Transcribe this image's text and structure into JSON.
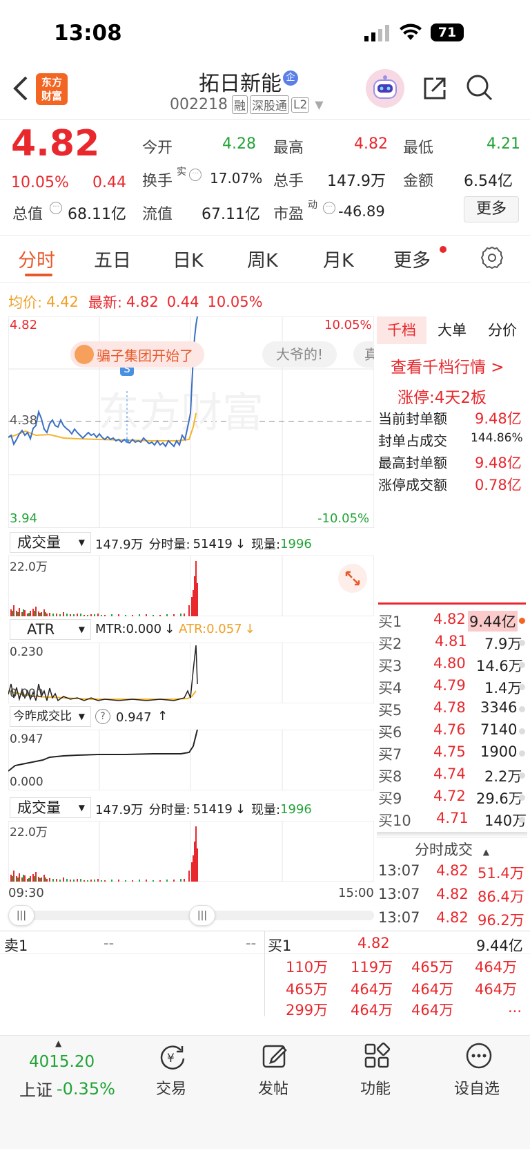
{
  "status": {
    "time": "13:08",
    "battery": "71"
  },
  "header": {
    "logo_line1": "东方",
    "logo_line2": "财富",
    "stock_name": "拓日新能",
    "badge": "企",
    "code": "002218",
    "tags": [
      "融",
      "深股通",
      "L2"
    ]
  },
  "quote": {
    "price": "4.82",
    "pct": "10.05%",
    "change": "0.44",
    "open_label": "今开",
    "open": "4.28",
    "high_label": "最高",
    "high": "4.82",
    "low_label": "最低",
    "low": "4.21",
    "turnover_label": "换手",
    "turnover_sup": "实",
    "turnover": "17.07%",
    "volume_label": "总手",
    "volume": "147.9万",
    "amount_label": "金额",
    "amount": "6.54亿",
    "mcap_label": "总值",
    "mcap": "68.11亿",
    "float_label": "流值",
    "float": "67.11亿",
    "pe_label": "市盈",
    "pe_sup": "动",
    "pe": "-46.89",
    "more_btn": "更多"
  },
  "tabs": [
    "分时",
    "五日",
    "日K",
    "周K",
    "月K",
    "更多"
  ],
  "intraday": {
    "avg_label": "均价:",
    "avg": "4.42",
    "latest_label": "最新:",
    "latest": "4.82",
    "latest_chg": "0.44",
    "latest_pct": "10.05%",
    "y_top": "4.82",
    "y_mid": "4.38",
    "y_bottom": "3.94",
    "pct_top": "10.05%",
    "pct_bottom": "-10.05%",
    "danmaku": [
      "骗子集团开始了",
      "大爷的!",
      "真"
    ],
    "watermark": "东方财富",
    "s_marker": "S"
  },
  "vol_panel": {
    "selector": "成交量",
    "total": "147.9万",
    "period_label": "分时量:",
    "period": "51419",
    "now_label": "现量:",
    "now": "1996",
    "ymax": "22.0万"
  },
  "atr_panel": {
    "selector": "ATR",
    "mtr": "MTR:0.000",
    "atr": "ATR:0.057",
    "ymax": "0.230",
    "ymin": "0.000"
  },
  "ratio_panel": {
    "selector": "今昨成交比",
    "value": "0.947",
    "ymax": "0.947",
    "ymin": "0.000"
  },
  "vol_panel2": {
    "selector": "成交量",
    "total": "147.9万",
    "period_label": "分时量:",
    "period": "51419",
    "now_label": "现量:",
    "now": "1996",
    "ymax": "22.0万"
  },
  "time_axis": {
    "start": "09:30",
    "end": "15:00"
  },
  "right_panel": {
    "tabs": [
      "千档",
      "大单",
      "分价"
    ],
    "link": "查看千档行情 >",
    "limit": "涨停:4天2板",
    "stats": [
      {
        "label": "当前封单额",
        "value": "9.48亿"
      },
      {
        "label": "封单占成交",
        "value": "144.86%"
      },
      {
        "label": "最高封单额",
        "value": "9.48亿"
      },
      {
        "label": "涨停成交额",
        "value": "0.78亿"
      }
    ],
    "bids": [
      {
        "label": "买1",
        "price": "4.82",
        "vol": "9.44亿"
      },
      {
        "label": "买2",
        "price": "4.81",
        "vol": "7.9万"
      },
      {
        "label": "买3",
        "price": "4.80",
        "vol": "14.6万"
      },
      {
        "label": "买4",
        "price": "4.79",
        "vol": "1.4万"
      },
      {
        "label": "买5",
        "price": "4.78",
        "vol": "3346"
      },
      {
        "label": "买6",
        "price": "4.76",
        "vol": "7140"
      },
      {
        "label": "买7",
        "price": "4.75",
        "vol": "1900"
      },
      {
        "label": "买8",
        "price": "4.74",
        "vol": "2.2万"
      },
      {
        "label": "买9",
        "price": "4.72",
        "vol": "29.6万"
      },
      {
        "label": "买10",
        "price": "4.71",
        "vol": "140万"
      }
    ],
    "trades_title": "分时成交",
    "trades": [
      {
        "time": "13:07",
        "price": "4.82",
        "vol": "51.4万"
      },
      {
        "time": "13:07",
        "price": "4.82",
        "vol": "86.4万"
      },
      {
        "time": "13:07",
        "price": "4.82",
        "vol": "96.2万"
      }
    ]
  },
  "queue": {
    "sell_label": "卖1",
    "sell_a": "--",
    "sell_b": "--",
    "buy_label": "买1",
    "buy_price": "4.82",
    "buy_vol": "9.44亿",
    "rows": [
      [
        "110万",
        "119万",
        "465万",
        "464万"
      ],
      [
        "465万",
        "464万",
        "464万",
        "464万"
      ],
      [
        "299万",
        "464万",
        "464万",
        "..."
      ]
    ]
  },
  "bottom": {
    "index_value": "4015.20",
    "index_name": "上证",
    "index_pct": "-0.35%",
    "buttons": [
      "交易",
      "发帖",
      "功能",
      "设自选"
    ]
  }
}
